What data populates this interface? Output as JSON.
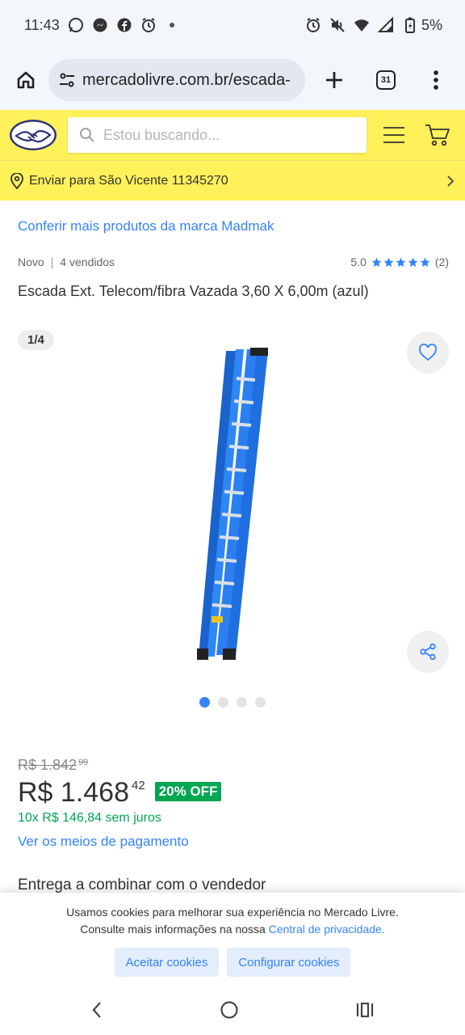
{
  "status_bar": {
    "time": "11:43",
    "battery": "5%"
  },
  "browser": {
    "url": "mercadolivre.com.br/escada-",
    "tab_count": "31"
  },
  "header": {
    "search_placeholder": "Estou buscando..."
  },
  "shipping": {
    "label": "Enviar para São Vicente 11345270"
  },
  "product": {
    "brand_link": "Conferir mais produtos da marca Madmak",
    "condition": "Novo",
    "sold": "4 vendidos",
    "rating_value": "5.0",
    "rating_count": "(2)",
    "title": "Escada Ext. Telecom/fibra Vazada 3,60 X 6,00m (azul)",
    "image_counter": "1/4",
    "images_total": 4,
    "active_image": 1
  },
  "pricing": {
    "old_price": "R$ 1.842",
    "old_price_cents": "99",
    "price": "R$ 1.468",
    "price_cents": "42",
    "discount": "20% OFF",
    "installments": "10x R$ 146,84 sem juros",
    "payment_link": "Ver os meios de pagamento"
  },
  "delivery": {
    "label": "Entrega a combinar com o vendedor"
  },
  "cookies": {
    "line1": "Usamos cookies para melhorar sua experiência no Mercado Livre.",
    "line2": "Consulte mais informações na nossa",
    "privacy_link": "Central de privacidade.",
    "accept": "Aceitar cookies",
    "configure": "Configurar cookies"
  },
  "colors": {
    "brand_yellow": "#fff159",
    "link_blue": "#3483fa",
    "success_green": "#00a650"
  }
}
